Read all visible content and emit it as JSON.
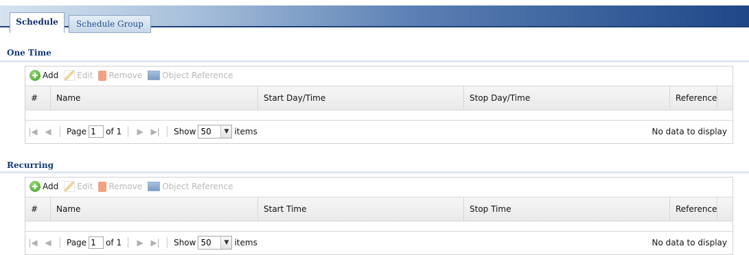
{
  "tabs": [
    {
      "label": "Schedule"
    },
    {
      "label": "Schedule Group"
    }
  ],
  "one_time": {
    "title": "One Time",
    "toolbar": {
      "add": "Add",
      "edit": "Edit",
      "remove": "Remove",
      "object_reference": "Object Reference"
    },
    "columns": [
      "#",
      "Name",
      "Start Day/Time",
      "Stop Day/Time",
      "Reference"
    ],
    "pager": {
      "page_label": "Page",
      "page_value": "1",
      "of_label": "of 1",
      "show_label": "Show",
      "show_value": "50",
      "items_label": "items",
      "status": "No data to display"
    }
  },
  "recurring": {
    "title": "Recurring",
    "toolbar": {
      "add": "Add",
      "edit": "Edit",
      "remove": "Remove",
      "object_reference": "Object Reference"
    },
    "columns": [
      "#",
      "Name",
      "Start Time",
      "Stop Time",
      "Reference"
    ],
    "pager": {
      "page_label": "Page",
      "page_value": "1",
      "of_label": "of 1",
      "show_label": "Show",
      "show_value": "50",
      "items_label": "items",
      "status": "No data to display"
    }
  },
  "icons": {
    "add": "add-icon",
    "edit": "edit-icon",
    "remove": "trash-icon",
    "object_reference": "object-reference-icon",
    "first": "first-page-icon",
    "prev": "previous-page-icon",
    "next": "next-page-icon",
    "last": "last-page-icon",
    "dropdown": "chevron-down-icon"
  },
  "colors": {
    "tab_text": "#0f2f6b",
    "section_title": "#123a73",
    "tabbar_dark": "#1f4788"
  }
}
